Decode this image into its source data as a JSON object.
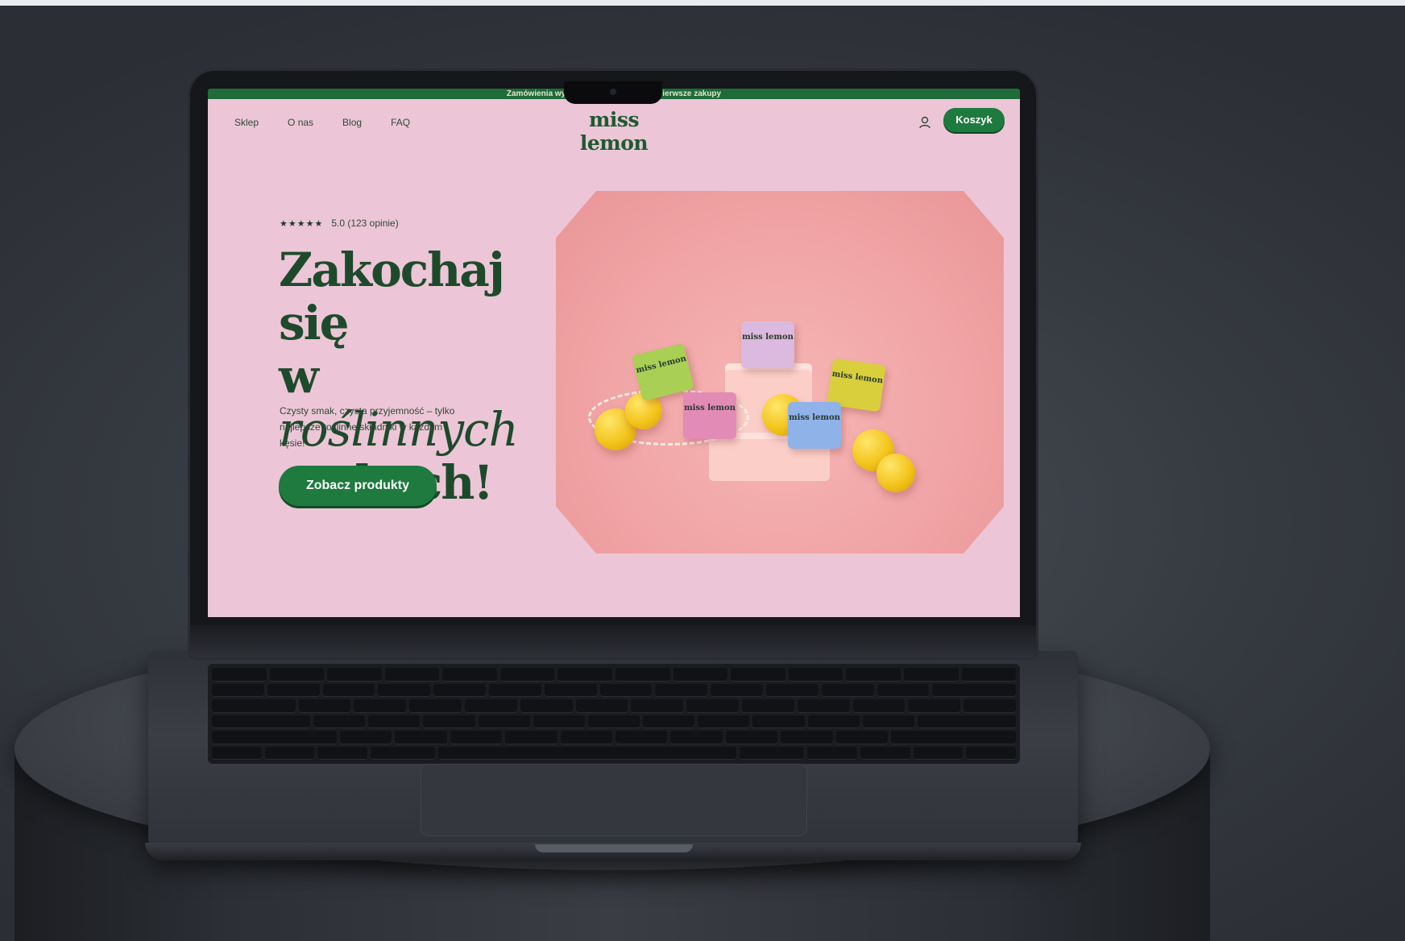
{
  "site": {
    "announcement": "Zamówienia wysyłamy w 24h · -10% na pierwsze zakupy",
    "brand": "miss lemon",
    "nav": [
      {
        "label": "Sklep"
      },
      {
        "label": "O nas"
      },
      {
        "label": "Blog"
      },
      {
        "label": "FAQ"
      }
    ],
    "cart_label": "Koszyk",
    "icons": {
      "account": "user-icon"
    }
  },
  "hero": {
    "stars": "★★★★★",
    "rating_text": "5.0 (123 opinie)",
    "headline_line1": "Zakochaj się",
    "headline_w": "w",
    "headline_italic": "roślinnych",
    "headline_line3": "serkach!",
    "subtext": "Czysty smak, czysta przyjemność – tylko najlepsze roślinne składniki w każdym kęsie!",
    "cta_label": "Zobacz produkty"
  },
  "product_boxes": [
    {
      "label": "miss lemon",
      "color": "#a9cf55"
    },
    {
      "label": "miss lemon",
      "color": "#e28bb7"
    },
    {
      "label": "miss lemon",
      "color": "#dcb9de"
    },
    {
      "label": "miss lemon",
      "color": "#d9cf3c"
    },
    {
      "label": "miss lemon",
      "color": "#8fb2e9"
    }
  ],
  "colors": {
    "brand_green": "#1e7a3e",
    "screen_pink": "#ecc6d6",
    "hero_pink": "#f0a3a4"
  }
}
